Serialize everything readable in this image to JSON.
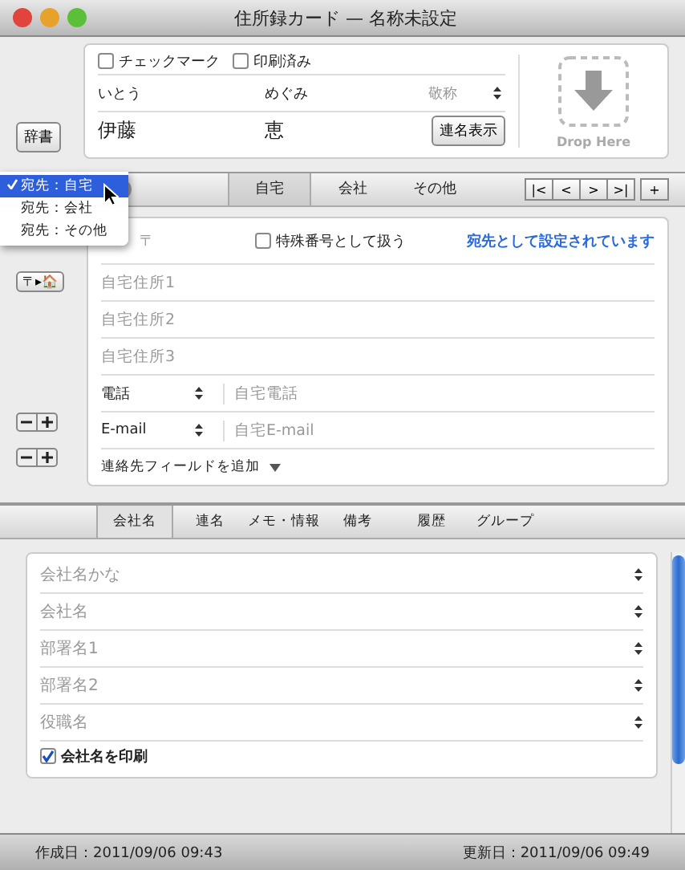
{
  "window": {
    "title": "住所録カード — 名称未設定"
  },
  "header": {
    "checkboxes": [
      {
        "label": "チェックマーク",
        "checked": false
      },
      {
        "label": "印刷済み",
        "checked": false
      }
    ],
    "dictionary_button": "辞書",
    "reading_last": "いとう",
    "reading_first": "めぐみ",
    "honorific_placeholder": "敬称",
    "last_name": "伊藤",
    "first_name": "恵",
    "joint_name_button": "連名表示",
    "drop_label": "Drop Here"
  },
  "address_tabs": [
    {
      "label": "自宅",
      "selected": true
    },
    {
      "label": "会社",
      "selected": false
    },
    {
      "label": "その他",
      "selected": false
    }
  ],
  "nav_buttons": [
    "|<",
    "<",
    ">",
    ">|",
    "+"
  ],
  "recipient_menu": [
    {
      "label": "宛先：自宅",
      "selected": true
    },
    {
      "label": "宛先：会社",
      "selected": false
    },
    {
      "label": "宛先：その他",
      "selected": false
    }
  ],
  "address": {
    "zip_placeholder": "〒",
    "special_number": {
      "label": "特殊番号として扱う",
      "checked": false
    },
    "recipient_note": "宛先として設定されています",
    "zip_button": "〒▸🏠",
    "lines": [
      "自宅住所1",
      "自宅住所2",
      "自宅住所3"
    ],
    "contacts": [
      {
        "type": "電話",
        "placeholder": "自宅電話"
      },
      {
        "type": "E-mail",
        "placeholder": "自宅E-mail"
      }
    ],
    "add_field": "連絡先フィールドを追加"
  },
  "detail_tabs": [
    {
      "label": "会社名",
      "selected": true
    },
    {
      "label": "連名",
      "selected": false
    },
    {
      "label": "メモ・情報",
      "selected": false
    },
    {
      "label": "備考",
      "selected": false
    },
    {
      "label": "履歴",
      "selected": false
    },
    {
      "label": "グループ",
      "selected": false
    }
  ],
  "company": {
    "fields": [
      "会社名かな",
      "会社名",
      "部署名1",
      "部署名2",
      "役職名"
    ],
    "print_company": {
      "label": "会社名を印刷",
      "checked": true
    }
  },
  "status_bar": {
    "created": "作成日：2011/09/06 09:43",
    "updated": "更新日：2011/09/06 09:49"
  }
}
